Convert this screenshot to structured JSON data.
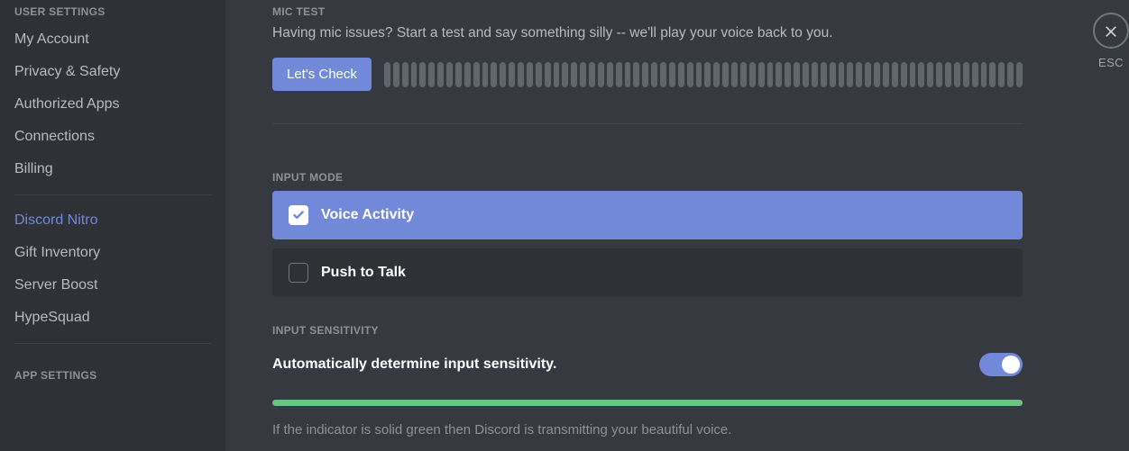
{
  "sidebar": {
    "user_settings_header": "USER SETTINGS",
    "app_settings_header": "APP SETTINGS",
    "items": {
      "my_account": "My Account",
      "privacy_safety": "Privacy & Safety",
      "authorized_apps": "Authorized Apps",
      "connections": "Connections",
      "billing": "Billing",
      "discord_nitro": "Discord Nitro",
      "gift_inventory": "Gift Inventory",
      "server_boost": "Server Boost",
      "hypesquad": "HypeSquad"
    }
  },
  "mic_test": {
    "header": "MIC TEST",
    "description": "Having mic issues? Start a test and say something silly -- we'll play your voice back to you.",
    "button_label": "Let's Check"
  },
  "input_mode": {
    "header": "INPUT MODE",
    "voice_activity": "Voice Activity",
    "push_to_talk": "Push to Talk"
  },
  "input_sensitivity": {
    "header": "INPUT SENSITIVITY",
    "auto_label": "Automatically determine input sensitivity.",
    "note": "If the indicator is solid green then Discord is transmitting your beautiful voice."
  },
  "close": {
    "esc_label": "ESC"
  }
}
